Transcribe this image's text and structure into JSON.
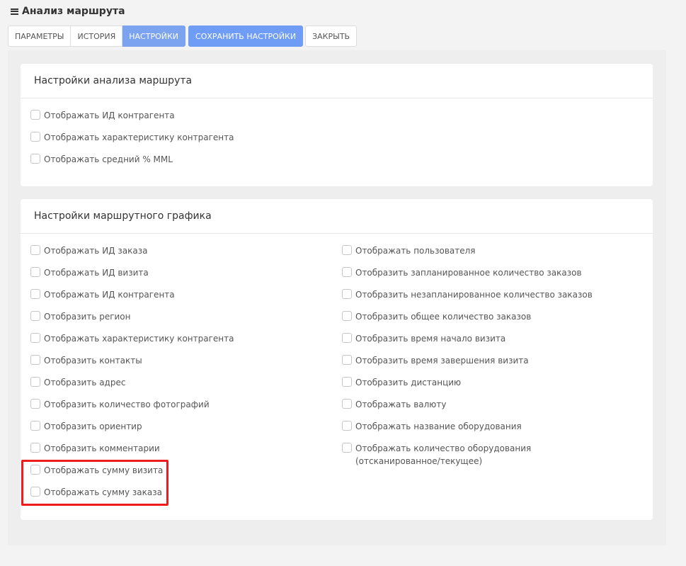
{
  "header": {
    "title": "Анализ маршрута"
  },
  "toolbar": {
    "tab_params": "ПАРАМЕТРЫ",
    "tab_history": "ИСТОРИЯ",
    "tab_settings": "НАСТРОЙКИ",
    "save_settings": "СОХРАНИТЬ НАСТРОЙКИ",
    "close": "ЗАКРЫТЬ"
  },
  "route_analysis": {
    "title": "Настройки анализа маршрута",
    "items": [
      {
        "label": "Отображать ИД контрагента",
        "checked": false
      },
      {
        "label": "Отображать характеристику контрагента",
        "checked": false
      },
      {
        "label": "Отображать средний % MML",
        "checked": false
      }
    ]
  },
  "route_schedule": {
    "title": "Настройки маршрутного графика",
    "left_items": [
      {
        "label": "Отображать ИД заказа",
        "checked": false
      },
      {
        "label": "Отображать ИД визита",
        "checked": false
      },
      {
        "label": "Отображать ИД контрагента",
        "checked": false
      },
      {
        "label": "Отобразить регион",
        "checked": false
      },
      {
        "label": "Отображать характеристику контрагента",
        "checked": false
      },
      {
        "label": "Отобразить контакты",
        "checked": false
      },
      {
        "label": "Отобразить адрес",
        "checked": false
      },
      {
        "label": "Отобразить количество фотографий",
        "checked": false
      },
      {
        "label": "Отобразить ориентир",
        "checked": false
      },
      {
        "label": "Отобразить комментарии",
        "checked": false
      },
      {
        "label": "Отображать сумму визита",
        "checked": false
      },
      {
        "label": "Отображать сумму заказа",
        "checked": false
      }
    ],
    "right_items": [
      {
        "label": "Отображать пользователя",
        "checked": false
      },
      {
        "label": "Отобразить запланированное количество заказов",
        "checked": false
      },
      {
        "label": "Отобразить незапланированное количество заказов",
        "checked": false
      },
      {
        "label": "Отобразить общее количество заказов",
        "checked": false
      },
      {
        "label": "Отобразить время начало визита",
        "checked": false
      },
      {
        "label": "Отобразить время завершения визита",
        "checked": false
      },
      {
        "label": "Отобразить дистанцию",
        "checked": false
      },
      {
        "label": "Отображать валюту",
        "checked": false
      },
      {
        "label": "Отображать название оборудования",
        "checked": false
      },
      {
        "label": "Отображать количество оборудования (отсканированное/текущее)",
        "checked": false
      }
    ]
  },
  "colors": {
    "accent": "#6f9cf5",
    "active_tab": "#7ba3f0",
    "highlight": "#ee1c1c"
  }
}
